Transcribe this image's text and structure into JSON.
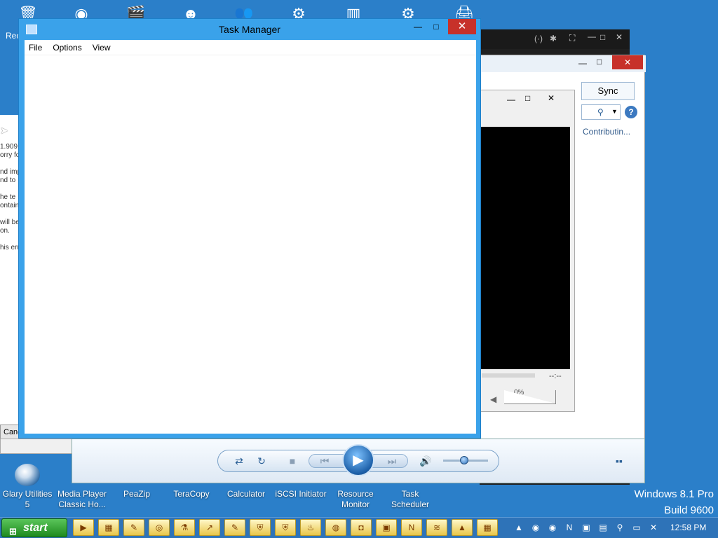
{
  "desktop": {
    "top_icons": [
      {
        "icon": "recycle-bin-icon",
        "glyph": "🗑"
      },
      {
        "icon": "gimp-icon",
        "glyph": "◉"
      },
      {
        "icon": "movie-clapper-icon",
        "glyph": "🎬"
      },
      {
        "icon": "pidgin-icon",
        "glyph": "☻"
      },
      {
        "icon": "users-icon",
        "glyph": "👥"
      },
      {
        "icon": "gear-icon",
        "glyph": "⚙"
      },
      {
        "icon": "server-icon",
        "glyph": "▥"
      },
      {
        "icon": "settings-icon",
        "glyph": "⚙"
      },
      {
        "icon": "printer-icon",
        "glyph": "🖨"
      }
    ],
    "top_left_label": "Rec",
    "bottom_icons": [
      {
        "label": "Glary Utilities 5"
      },
      {
        "label": "Media Player Classic Ho..."
      },
      {
        "label": "PeaZip"
      },
      {
        "label": "TeraCopy"
      },
      {
        "label": "Calculator"
      },
      {
        "label": "iSCSI Initiator"
      },
      {
        "label": "Resource Monitor"
      },
      {
        "label": "Task Scheduler"
      }
    ],
    "watermark_line1": "Windows 8.1 Pro",
    "watermark_line2": "Build 9600"
  },
  "background_windows": {
    "left_partial_lines": [
      "1.909",
      "orry fo",
      "",
      "nd imp",
      "nd to",
      "",
      "he te",
      "ontain",
      "",
      "will be",
      "on.",
      "",
      "his err"
    ],
    "left_partial_button": "Canc",
    "sync_tab": "Sync",
    "contributing": "Contributin...",
    "wmp_time": "--:--",
    "wmp_volume_pct": "0%"
  },
  "task_manager": {
    "title": "Task Manager",
    "menu": [
      "File",
      "Options",
      "View"
    ],
    "minimize": "—",
    "maximize": "□",
    "close": "✕"
  },
  "taskbar": {
    "start_label": "start",
    "start_flag": "⊞",
    "pinned": [
      "▶",
      "▦",
      "✎",
      "◎",
      "⚗",
      "↗",
      "✎",
      "⛨",
      "⛨",
      "♨",
      "◍",
      "◘",
      "▣",
      "N",
      "≋",
      "▲",
      "▦"
    ],
    "tray": [
      "▲",
      "◉",
      "◉",
      "N",
      "▣",
      "▤",
      "⚲",
      "▭",
      "✕"
    ],
    "clock": "12:58 PM"
  }
}
